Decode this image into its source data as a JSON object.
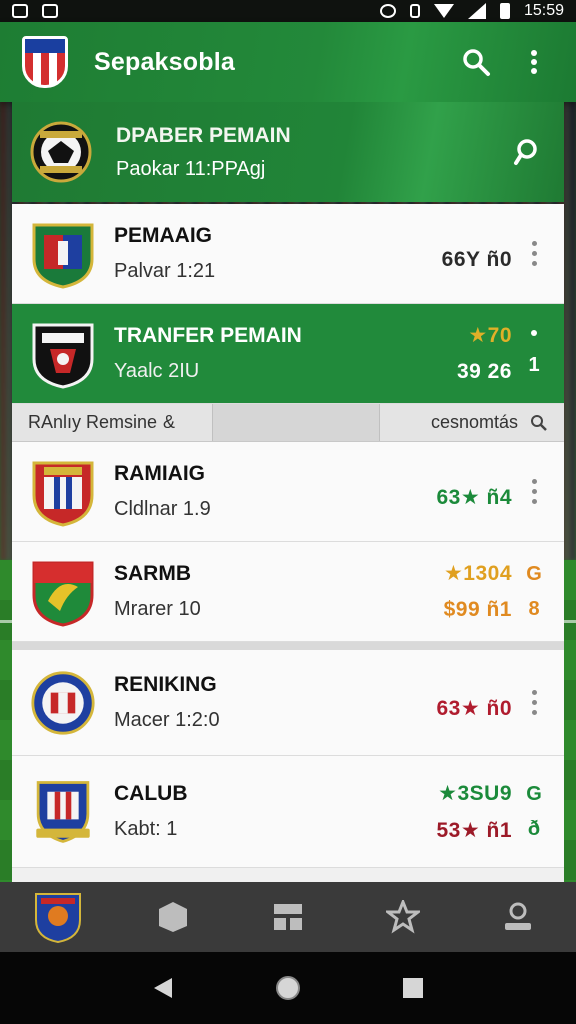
{
  "status_bar": {
    "time": "15:59"
  },
  "app_bar": {
    "title": "Sepaksobla"
  },
  "featured": {
    "title": "DPABER PEMAIN",
    "subtitle": "Paokar 11:PPAgj"
  },
  "rows_top": [
    {
      "name": "PEMAAIG",
      "meta": "Palvar  1:21",
      "stat1": "",
      "stat2": "66Y  ñ0",
      "stat2_color": "#2a2a2a",
      "variant": "white",
      "trailing": "more"
    },
    {
      "name": "TRANFER PEMAIN",
      "meta": "Yaalc  2IU",
      "stat1": "★70",
      "stat1_color": "#e0b028",
      "stat2": "39  26",
      "stat2_color": "#ffffff",
      "variant": "green",
      "trailing": "more",
      "trailing_text": "1"
    }
  ],
  "filter_bar": {
    "left_label": "RAnlıy  Remsine",
    "left_icon": "&",
    "right_label": "cesnomtás"
  },
  "rows_bottom": [
    {
      "name": "RAMIAIG",
      "meta": "Cldlnar  1.9",
      "stat1": "",
      "stat2": "63★ ñ4",
      "stat2_color": "#1b8a3a",
      "trailing": "more"
    },
    {
      "name": "SARMB",
      "meta": "Mrarer  10",
      "stat1": "★1304",
      "stat1_color": "#e0a020",
      "stat2": "$99  ñ1",
      "stat2_color": "#e08a20",
      "trailing": "tag",
      "tag_top": "G",
      "tag_bottom": "8",
      "tag_color": "#e08a20"
    }
  ],
  "rows_bottom2": [
    {
      "name": "RENIKING",
      "meta": "Macer  1:2:0",
      "stat1": "",
      "stat2": "63★ ñ0",
      "stat2_color": "#b01c2e",
      "trailing": "more"
    },
    {
      "name": "CALUB",
      "meta": "Kabt:    1",
      "stat1": "★3SU9",
      "stat1_color": "#1b8a3a",
      "stat2": "53★ ñ1",
      "stat2_color": "#9c1a28",
      "trailing": "tag",
      "tag_top": "G",
      "tag_bottom": "ð",
      "tag_color": "#1b8a3a"
    }
  ],
  "bottom_nav": [
    "club-badge",
    "shield",
    "lineup",
    "favorites",
    "profile"
  ],
  "colors": {
    "primary": "#218a3b",
    "accent_gold": "#e0b028"
  }
}
